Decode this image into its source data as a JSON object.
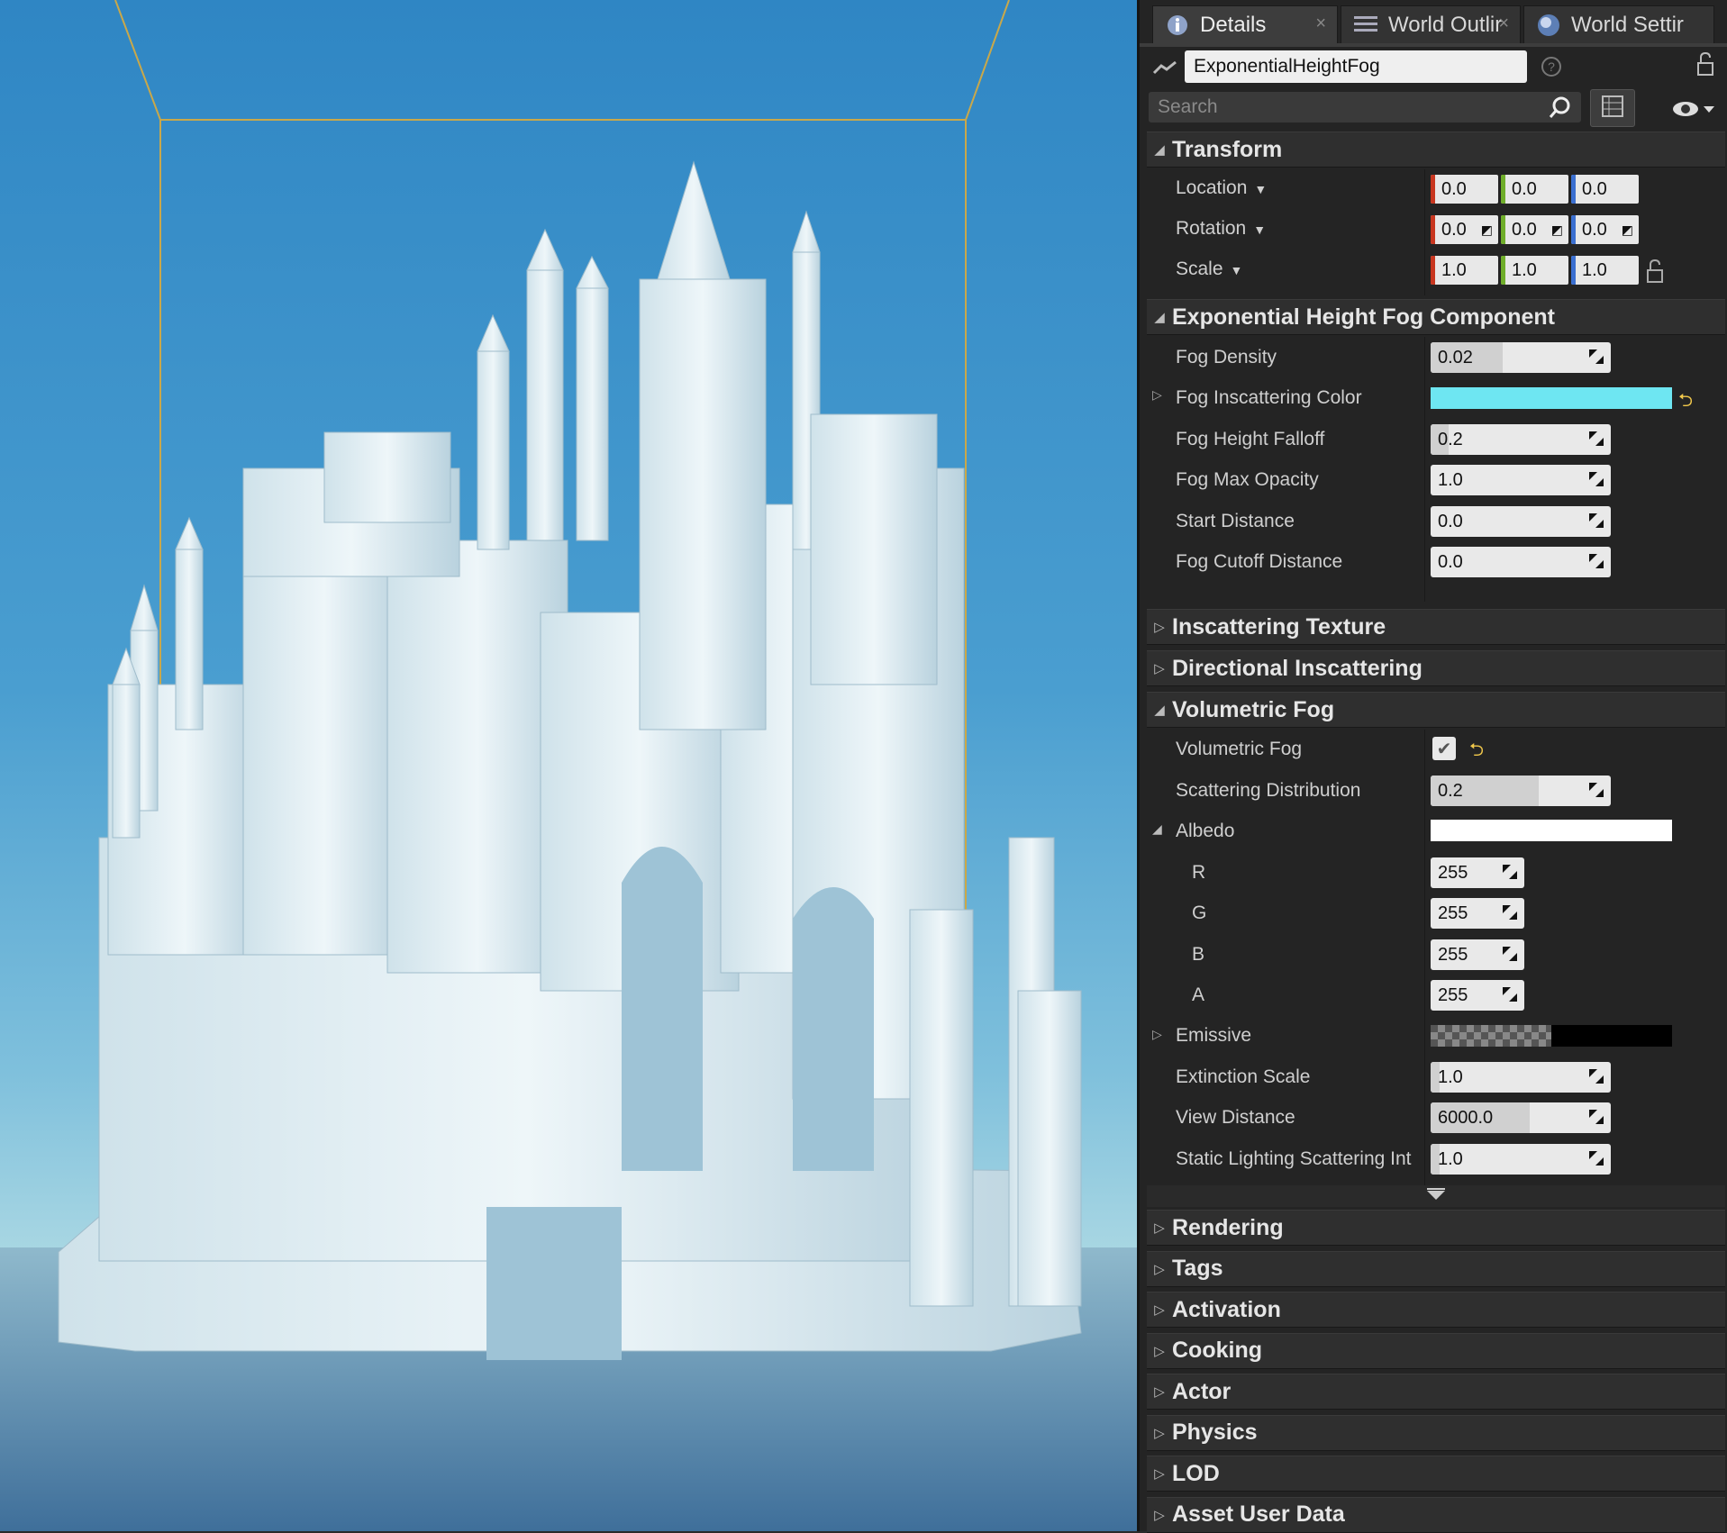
{
  "tabs": [
    {
      "label": "Details",
      "icon": "info-icon"
    },
    {
      "label": "World Outlir",
      "icon": "list-icon"
    },
    {
      "label": "World Settir",
      "icon": "globe-icon"
    }
  ],
  "actor_name": "ExponentialHeightFog",
  "search": {
    "placeholder": "Search"
  },
  "transform": {
    "title": "Transform",
    "location": {
      "label": "Location",
      "x": "0.0",
      "y": "0.0",
      "z": "0.0"
    },
    "rotation": {
      "label": "Rotation",
      "x": "0.0",
      "y": "0.0",
      "z": "0.0"
    },
    "scale": {
      "label": "Scale",
      "x": "1.0",
      "y": "1.0",
      "z": "1.0"
    }
  },
  "fog_component": {
    "title": "Exponential Height Fog Component",
    "fog_density": {
      "label": "Fog Density",
      "value": "0.02",
      "fill": 0.4
    },
    "fog_inscattering_color": {
      "label": "Fog Inscattering Color",
      "color": "#6ee6f2"
    },
    "fog_height_falloff": {
      "label": "Fog Height Falloff",
      "value": "0.2",
      "fill": 0.1
    },
    "fog_max_opacity": {
      "label": "Fog Max Opacity",
      "value": "1.0",
      "fill": 0
    },
    "start_distance": {
      "label": "Start Distance",
      "value": "0.0",
      "fill": 0
    },
    "fog_cutoff_distance": {
      "label": "Fog Cutoff Distance",
      "value": "0.0",
      "fill": 0
    }
  },
  "collapsed_top": [
    "Inscattering Texture",
    "Directional Inscattering"
  ],
  "volumetric": {
    "title": "Volumetric Fog",
    "volumetric_fog": {
      "label": "Volumetric Fog",
      "checked": true
    },
    "scattering_distribution": {
      "label": "Scattering Distribution",
      "value": "0.2",
      "fill": 0.6
    },
    "albedo": {
      "label": "Albedo",
      "color": "#ffffff",
      "r": {
        "label": "R",
        "value": "255"
      },
      "g": {
        "label": "G",
        "value": "255"
      },
      "b": {
        "label": "B",
        "value": "255"
      },
      "a": {
        "label": "A",
        "value": "255"
      }
    },
    "emissive": {
      "label": "Emissive",
      "color": "#000000"
    },
    "extinction_scale": {
      "label": "Extinction Scale",
      "value": "1.0",
      "fill": 0.05
    },
    "view_distance": {
      "label": "View Distance",
      "value": "6000.0",
      "fill": 0.55
    },
    "static_lighting": {
      "label": "Static Lighting Scattering Int",
      "value": "1.0",
      "fill": 0.05
    }
  },
  "collapsed_bottom": [
    "Rendering",
    "Tags",
    "Activation",
    "Cooking",
    "Actor",
    "Physics",
    "LOD",
    "Asset User Data"
  ],
  "colors": {
    "x": "#c8361f",
    "y": "#6fae2a",
    "z": "#3a6fd1",
    "accent": "#f2c94c"
  }
}
